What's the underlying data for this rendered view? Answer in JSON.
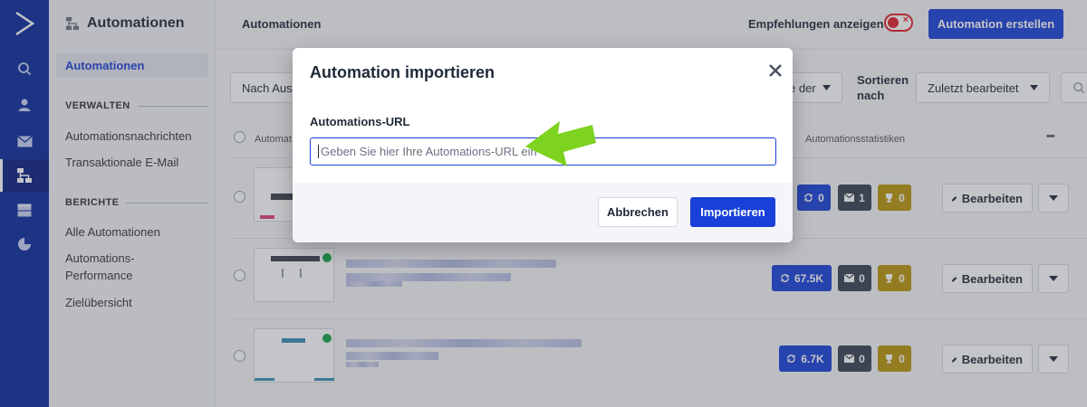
{
  "sidebar": {
    "heading": "Automationen",
    "active_item": "Automationen",
    "section_manage": "VERWALTEN",
    "manage_items": [
      "Automationsnachrichten",
      "Transaktionale E-Mail"
    ],
    "section_reports": "BERICHTE",
    "report_items": [
      "Alle Automationen",
      "Automations-\nPerformance",
      "Zielübersicht"
    ]
  },
  "header": {
    "title": "Automationen",
    "recommendations_label": "Empfehlungen anzeigen",
    "recommendations_enabled": false,
    "create_button": "Automation erstellen"
  },
  "filters": {
    "left_filter": "Nach Ausl",
    "middle_filter": "e der",
    "sort_label": "Sortieren\nnach",
    "sort_value": "Zuletzt bearbeitet"
  },
  "table": {
    "col_name": "Automat",
    "col_stats": "Automationsstatistiken",
    "more": "•••",
    "rows": [
      {
        "contacts": "0",
        "emails": "1",
        "goals": "0",
        "action": "Bearbeiten"
      },
      {
        "contacts": "67.5K",
        "emails": "0",
        "goals": "0",
        "action": "Bearbeiten"
      },
      {
        "contacts": "6.7K",
        "emails": "0",
        "goals": "0",
        "action": "Bearbeiten"
      }
    ]
  },
  "modal": {
    "title": "Automation importieren",
    "field_label": "Automations-URL",
    "field_placeholder": "Geben Sie hier Ihre Automations-URL ein",
    "cancel_button": "Abbrechen",
    "import_button": "Importieren"
  },
  "colors": {
    "brand_blue": "#1940d8",
    "rail_blue": "#0a2a9c",
    "highlight_arrow": "#7ed321"
  }
}
